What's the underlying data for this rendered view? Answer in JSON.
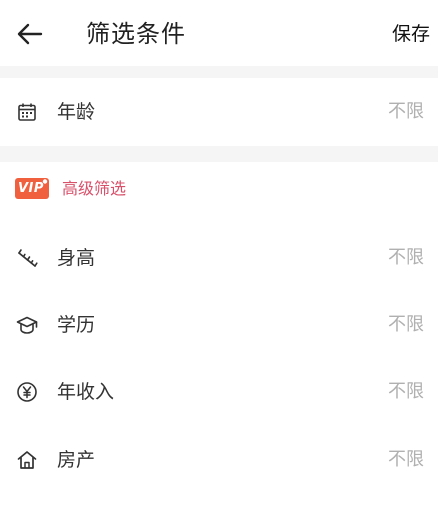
{
  "header": {
    "title": "筛选条件",
    "save_label": "保存"
  },
  "basic": {
    "items": [
      {
        "icon": "calendar-icon",
        "label": "年龄",
        "value": "不限"
      }
    ]
  },
  "vip_section": {
    "badge_text": "VIP",
    "title": "高级筛选",
    "accent_color": "#d9506a",
    "badge_color": "#f0603e",
    "items": [
      {
        "icon": "ruler-icon",
        "label": "身高",
        "value": "不限"
      },
      {
        "icon": "graduation-cap-icon",
        "label": "学历",
        "value": "不限"
      },
      {
        "icon": "yen-icon",
        "label": "年收入",
        "value": "不限"
      },
      {
        "icon": "house-icon",
        "label": "房产",
        "value": "不限"
      }
    ]
  }
}
